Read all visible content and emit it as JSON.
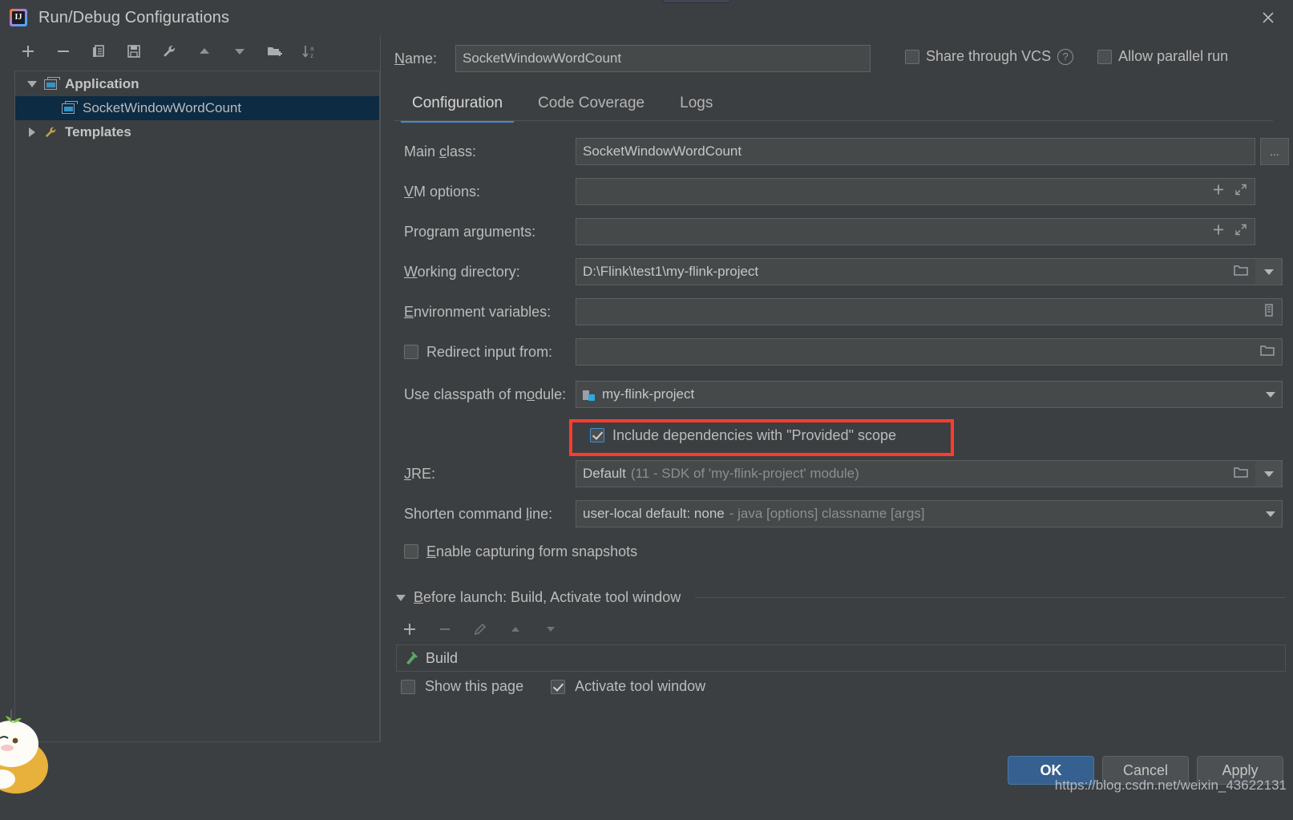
{
  "window": {
    "title": "Run/Debug Configurations",
    "app_icon": "intellij-idea-icon",
    "close_icon": "close-icon"
  },
  "left_panel": {
    "toolbar": [
      {
        "name": "add-configuration-button",
        "icon": "plus-icon",
        "label": "+"
      },
      {
        "name": "remove-configuration-button",
        "icon": "minus-icon",
        "label": "−"
      },
      {
        "name": "copy-configuration-button",
        "icon": "copy-icon",
        "label": "Copy"
      },
      {
        "name": "save-configuration-button",
        "icon": "save-icon",
        "label": "Save"
      },
      {
        "name": "edit-templates-button",
        "icon": "wrench-icon",
        "label": "Edit Templates"
      },
      {
        "name": "move-up-button",
        "icon": "arrow-up-icon",
        "label": "Move Up"
      },
      {
        "name": "move-down-button",
        "icon": "arrow-down-icon",
        "label": "Move Down"
      },
      {
        "name": "new-folder-button",
        "icon": "folder-add-icon",
        "label": "New Folder"
      },
      {
        "name": "sort-button",
        "icon": "sort-az-icon",
        "label": "Sort Configurations"
      }
    ],
    "tree": [
      {
        "label": "Application",
        "icon": "application-icon",
        "expanded": true,
        "bold": true,
        "level": 0,
        "selected": false
      },
      {
        "label": "SocketWindowWordCount",
        "icon": "application-icon",
        "expanded": null,
        "bold": false,
        "level": 1,
        "selected": true
      },
      {
        "label": "Templates",
        "icon": "wrench-icon",
        "expanded": false,
        "bold": true,
        "level": 0,
        "selected": false
      }
    ]
  },
  "header": {
    "name_label": "Name:",
    "name_value": "SocketWindowWordCount",
    "name_placeholder": "",
    "share_vcs_label": "Share through VCS",
    "share_vcs_checked": false,
    "help_icon": "question-mark-icon",
    "allow_parallel_label": "Allow parallel run",
    "allow_parallel_checked": false
  },
  "tabs": [
    {
      "label": "Configuration",
      "active": true
    },
    {
      "label": "Code Coverage",
      "active": false
    },
    {
      "label": "Logs",
      "active": false
    }
  ],
  "form": {
    "main_class": {
      "label": "Main class:",
      "value": "SocketWindowWordCount",
      "browse_label": "...",
      "browse_icon": "ellipsis-icon"
    },
    "vm_options": {
      "label": "VM options:",
      "value": "",
      "macro_icon": "plus-icon",
      "expand_icon": "expand-icon"
    },
    "program_arguments": {
      "label": "Program arguments:",
      "value": "",
      "macro_icon": "plus-icon",
      "expand_icon": "expand-icon"
    },
    "working_directory": {
      "label": "Working directory:",
      "value": "D:\\Flink\\test1\\my-flink-project",
      "browse_icon": "folder-icon",
      "dropdown_icon": "chevron-down-icon"
    },
    "environment_variables": {
      "label": "Environment variables:",
      "value": "",
      "browse_icon": "list-edit-icon"
    },
    "redirect_input": {
      "label": "Redirect input from:",
      "checked": false,
      "value": "",
      "browse_icon": "folder-icon"
    },
    "use_classpath": {
      "label": "Use classpath of module:",
      "value": "my-flink-project",
      "module_icon": "module-icon",
      "dropdown_icon": "chevron-down-icon"
    },
    "include_provided": {
      "label": "Include dependencies with \"Provided\" scope",
      "checked": true,
      "highlighted": true,
      "highlight_color": "#ff3b30"
    },
    "jre": {
      "label": "JRE:",
      "value": "Default",
      "value_hint": "(11 - SDK of 'my-flink-project' module)",
      "browse_icon": "folder-icon",
      "dropdown_icon": "chevron-down-icon"
    },
    "shorten_command_line": {
      "label": "Shorten command line:",
      "value": "user-local default: none",
      "value_hint": "- java [options] classname [args]",
      "dropdown_icon": "chevron-down-icon"
    },
    "enable_capturing": {
      "label": "Enable capturing form snapshots",
      "checked": false
    }
  },
  "before_launch": {
    "title": "Before launch: Build, Activate tool window",
    "expanded": true,
    "collapse_icon": "triangle-down-icon",
    "toolbar": [
      {
        "name": "add-task-button",
        "icon": "plus-icon",
        "label": "+"
      },
      {
        "name": "remove-task-button",
        "icon": "minus-icon",
        "label": "−"
      },
      {
        "name": "edit-task-button",
        "icon": "pencil-icon",
        "label": "Edit"
      },
      {
        "name": "move-task-up-button",
        "icon": "arrow-up-icon",
        "label": "Up"
      },
      {
        "name": "move-task-down-button",
        "icon": "arrow-down-icon",
        "label": "Down"
      }
    ],
    "tasks": [
      {
        "label": "Build",
        "icon": "build-hammer-icon"
      }
    ],
    "show_this_page": {
      "label": "Show this page",
      "checked": false
    },
    "activate_tool_window": {
      "label": "Activate tool window",
      "checked": true
    }
  },
  "footer": {
    "buttons": [
      {
        "label": "OK",
        "name": "ok-button",
        "primary": true
      },
      {
        "label": "Cancel",
        "name": "cancel-button",
        "primary": false
      },
      {
        "label": "Apply",
        "name": "apply-button",
        "primary": false
      }
    ],
    "watermark": "https://blog.csdn.net/weixin_43622131"
  },
  "colors": {
    "background": "#3c3f41",
    "field_background": "#45494a",
    "border": "#5b5f60",
    "selection": "#0d2b42",
    "accent": "#4a88c7",
    "primary_button": "#36608f",
    "highlight": "#ff3b30",
    "text": "#bbbbbb",
    "dim_text": "#8b8f90"
  }
}
